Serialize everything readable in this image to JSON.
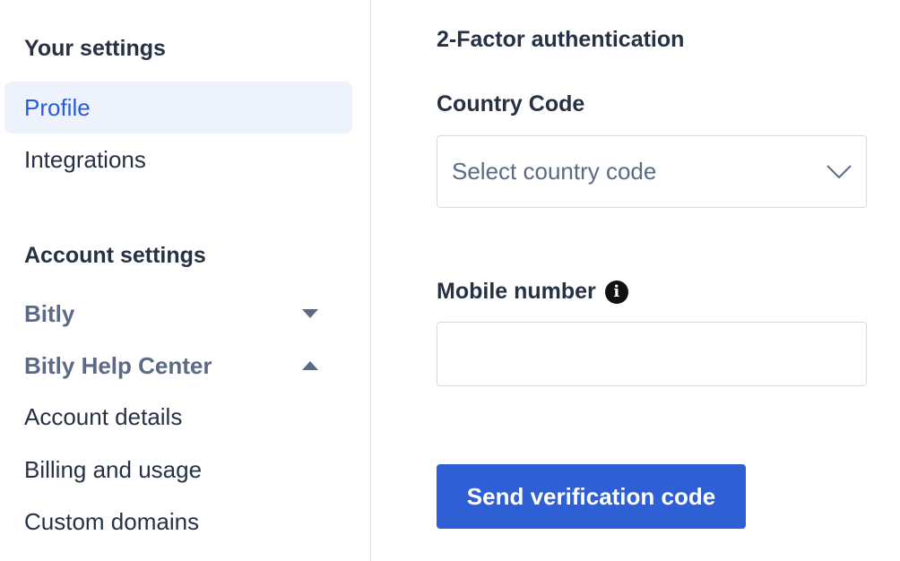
{
  "sidebar": {
    "your_settings_heading": "Your settings",
    "profile_label": "Profile",
    "integrations_label": "Integrations",
    "account_settings_heading": "Account settings",
    "groups": [
      {
        "label": "Bitly",
        "caret": "chevron-down"
      },
      {
        "label": "Bitly Help Center",
        "caret": "chevron-up"
      }
    ],
    "items": [
      "Account details",
      "Billing and usage",
      "Custom domains"
    ],
    "active_item": "Profile",
    "active_color": "#2a5bd7"
  },
  "main": {
    "title": "2-Factor authentication",
    "country_code": {
      "label": "Country Code",
      "placeholder": "Select country code"
    },
    "mobile_number": {
      "label": "Mobile number",
      "value": "",
      "icon": "info-icon"
    },
    "send_button_label": "Send verification code",
    "button_color": "#2f5fd5"
  }
}
